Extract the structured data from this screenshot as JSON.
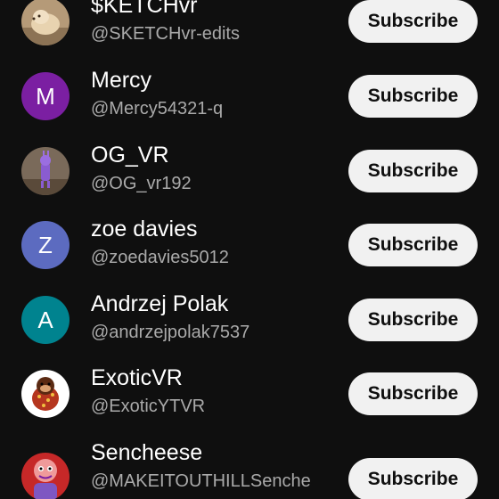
{
  "channels": [
    {
      "name": "$KETCHvr",
      "handle": "@SKETCHvr-edits",
      "avatar_letter": "",
      "avatar_type": "image-dog",
      "subscribe_label": "Subscribe"
    },
    {
      "name": "Mercy",
      "handle": "@Mercy54321-q",
      "avatar_letter": "M",
      "avatar_color": "#7b1fa2",
      "avatar_type": "letter",
      "subscribe_label": "Subscribe"
    },
    {
      "name": "OG_VR",
      "handle": "@OG_vr192",
      "avatar_letter": "",
      "avatar_type": "image-purple-figure",
      "subscribe_label": "Subscribe"
    },
    {
      "name": "zoe davies",
      "handle": "@zoedavies5012",
      "avatar_letter": "Z",
      "avatar_color": "#5c6bc0",
      "avatar_type": "letter",
      "subscribe_label": "Subscribe"
    },
    {
      "name": "Andrzej Polak",
      "handle": "@andrzejpolak7537",
      "avatar_letter": "A",
      "avatar_color": "#00838f",
      "avatar_type": "letter",
      "subscribe_label": "Subscribe"
    },
    {
      "name": "ExoticVR",
      "handle": "@ExoticYTVR",
      "avatar_letter": "",
      "avatar_type": "image-gorilla",
      "subscribe_label": "Subscribe"
    },
    {
      "name": "Sencheese",
      "handle": "@MAKEITOUTHILLSenche",
      "avatar_letter": "",
      "avatar_type": "image-red-character",
      "subscribe_label": "Subscribe"
    }
  ],
  "colors": {
    "background": "#0f0f0f",
    "name_text": "#ffffff",
    "handle_text": "#aaaaaa",
    "button_bg": "#f1f1f1",
    "button_text": "#0f0f0f"
  }
}
